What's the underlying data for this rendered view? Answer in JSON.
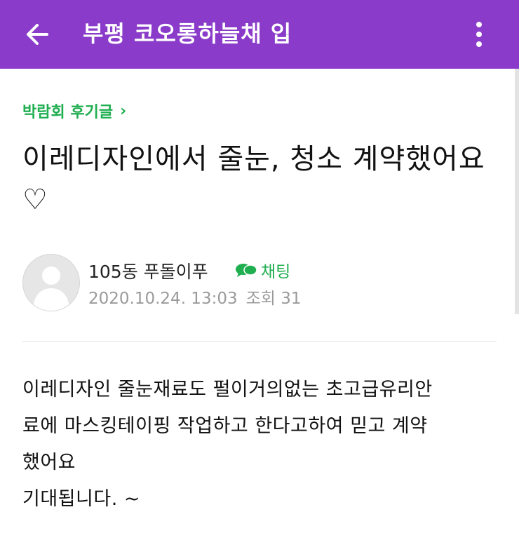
{
  "header": {
    "title": "부평 코오롱하늘채 입",
    "back_icon": "arrow-left-icon",
    "more_icon": "more-vertical-icon",
    "color": "#8a3bc9"
  },
  "post": {
    "board_label": "박람회 후기글",
    "board_chevron": "›",
    "title": "이레디자인에서 줄눈, 청소 계약했어요♡",
    "author": "105동 푸돌이푸",
    "chat_label": "채팅",
    "date": "2020.10.24. 13:03",
    "views_label": "조회 31",
    "body_lines": [
      "이레디자인 줄눈재료도 펄이거의없는 초고급유리안",
      "료에 마스킹테이핑 작업하고 한다고하여 믿고 계약",
      "했어요",
      "기대됩니다. ~"
    ]
  },
  "colors": {
    "accent_green": "#1fae50",
    "meta_gray": "#9a9a9a"
  }
}
